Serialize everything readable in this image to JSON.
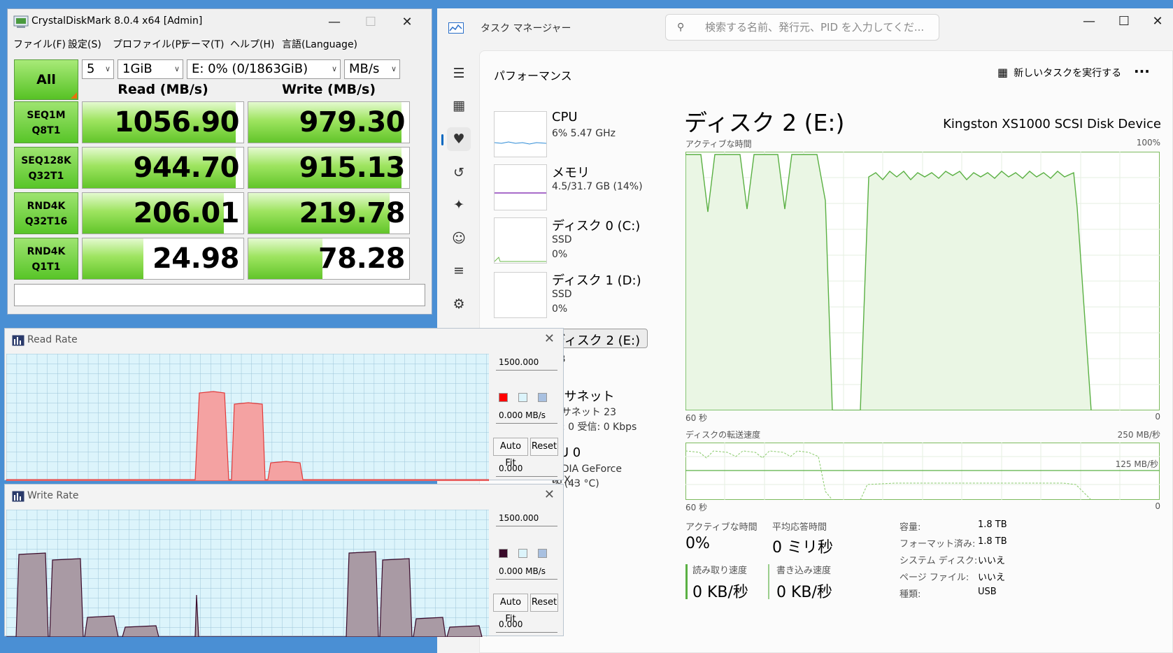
{
  "taskmanager": {
    "title": "タスク マネージャー",
    "search_placeholder": "検索する名前、発行元、PID を入力してくだ...",
    "section": "パフォーマンス",
    "run_new_task": "新しいタスクを実行する",
    "more": "...",
    "devices": [
      {
        "name": "CPU",
        "line1": "6% 5.47 GHz",
        "line2": ""
      },
      {
        "name": "メモリ",
        "line1": "4.5/31.7 GB (14%)",
        "line2": ""
      },
      {
        "name": "ディスク 0 (C:)",
        "line1": "SSD",
        "line2": "0%"
      },
      {
        "name": "ディスク 1 (D:)",
        "line1": "SSD",
        "line2": "0%"
      },
      {
        "name": "ディスク 2 (E:)",
        "line1": "SB",
        "line2": "%"
      },
      {
        "name": "ーサネット",
        "line1": "ーサネット 23",
        "line2": "信: 0 受信: 0 Kbps"
      },
      {
        "name": "PU 0",
        "line1": "VIDIA GeForce RTX...",
        "line2": "% (43 °C)"
      }
    ],
    "detail": {
      "heading": "ディスク 2 (E:)",
      "device_name": "Kingston XS1000 SCSI Disk Device",
      "chart1_label": "アクティブな時間",
      "chart1_max": "100%",
      "chart1_left": "60 秒",
      "chart1_right": "0",
      "chart2_label": "ディスクの転送速度",
      "chart2_max": "250 MB/秒",
      "chart2_mid": "125 MB/秒",
      "chart2_left": "60 秒",
      "chart2_right": "0",
      "active_label": "アクティブな時間",
      "active_value": "0%",
      "resp_label": "平均応答時間",
      "resp_value": "0 ミリ秒",
      "read_label": "読み取り速度",
      "read_value": "0 KB/秒",
      "write_label": "書き込み速度",
      "write_value": "0 KB/秒",
      "props": [
        {
          "k": "容量:",
          "v": "1.8 TB"
        },
        {
          "k": "フォーマット済み:",
          "v": "1.8 TB"
        },
        {
          "k": "システム ディスク:",
          "v": "いいえ"
        },
        {
          "k": "ページ ファイル:",
          "v": "いいえ"
        },
        {
          "k": "種類:",
          "v": "USB"
        }
      ]
    }
  },
  "cdm": {
    "title": "CrystalDiskMark 8.0.4 x64 [Admin]",
    "menu": [
      "ファイル(F)",
      "設定(S)",
      "プロファイル(P)",
      "テーマ(T)",
      "ヘルプ(H)",
      "言語(Language)"
    ],
    "all_label": "All",
    "count": "5",
    "size": "1GiB",
    "drive": "E: 0% (0/1863GiB)",
    "unit": "MB/s",
    "read_header": "Read (MB/s)",
    "write_header": "Write (MB/s)",
    "rows": [
      {
        "l1": "SEQ1M",
        "l2": "Q8T1",
        "read": "1056.90",
        "write": "979.30",
        "read_fill": 0.95,
        "write_fill": 0.95
      },
      {
        "l1": "SEQ128K",
        "l2": "Q32T1",
        "read": "944.70",
        "write": "915.13",
        "read_fill": 0.95,
        "write_fill": 0.95
      },
      {
        "l1": "RND4K",
        "l2": "Q32T16",
        "read": "206.01",
        "write": "219.78",
        "read_fill": 0.88,
        "write_fill": 0.88
      },
      {
        "l1": "RND4K",
        "l2": "Q1T1",
        "read": "24.98",
        "write": "78.28",
        "read_fill": 0.38,
        "write_fill": 0.46
      }
    ]
  },
  "read_rate": {
    "title": "Read Rate",
    "max": "1500.000",
    "current": "0.000 MB/s",
    "min": "0.000",
    "autofit": "Auto Fit",
    "reset": "Reset",
    "color": "#ff0000"
  },
  "write_rate": {
    "title": "Write Rate",
    "max": "1500.000",
    "current": "0.000 MB/s",
    "min": "0.000",
    "autofit": "Auto Fit",
    "reset": "Reset",
    "color": "#3a0a2a"
  }
}
